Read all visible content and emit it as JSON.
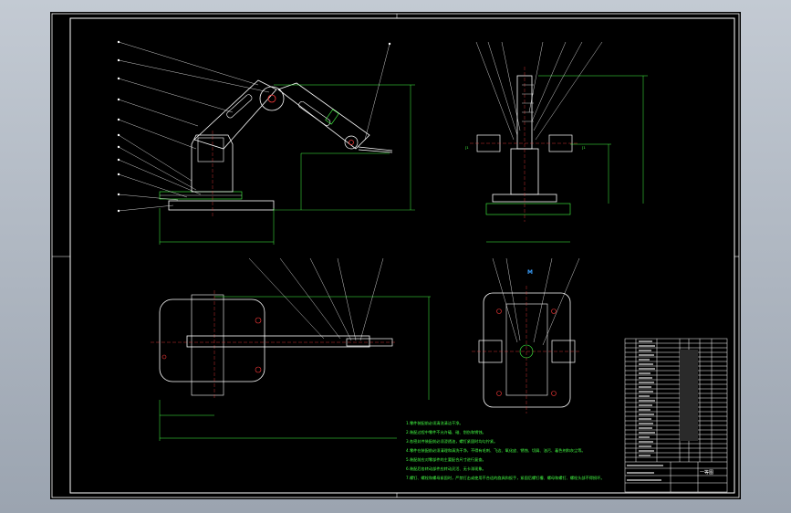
{
  "drawing": {
    "section_mark": "M",
    "side_mark_left": "[1",
    "side_mark_right": "[1",
    "title_block": {
      "drawing_name": "一等图"
    },
    "notes_lines": [
      "1.零件装配前必须清洗清洁干净。",
      "2.装配过程中零件不允许磕、碰、划伤和锈蚀。",
      "3.各密封件装配前必须浸透油，螺钉紧固时均匀拧紧。",
      "4.零件在装配前必须清理和清洗干净，不得有毛刺、飞边、氧化皮、锈蚀、切屑、油污、着色剂和灰尘等。",
      "5.装配前应对零部件的主要配合尺寸进行复查。",
      "6.装配后各转动部件应转动灵活、无卡滞现象。",
      "7.螺钉、螺栓和螺母紧固时，严禁打击或使用不合适的旋具和扳手，紧固后螺钉槽、螺母和螺钉、螺栓头部不得损坏。"
    ]
  },
  "colors": {
    "background": "#000000",
    "frame": "#ffffff",
    "dimension": "#44ff44",
    "centerline": "#ff3b3b",
    "leader": "#ffffff",
    "highlight": "#3aa0ff"
  }
}
